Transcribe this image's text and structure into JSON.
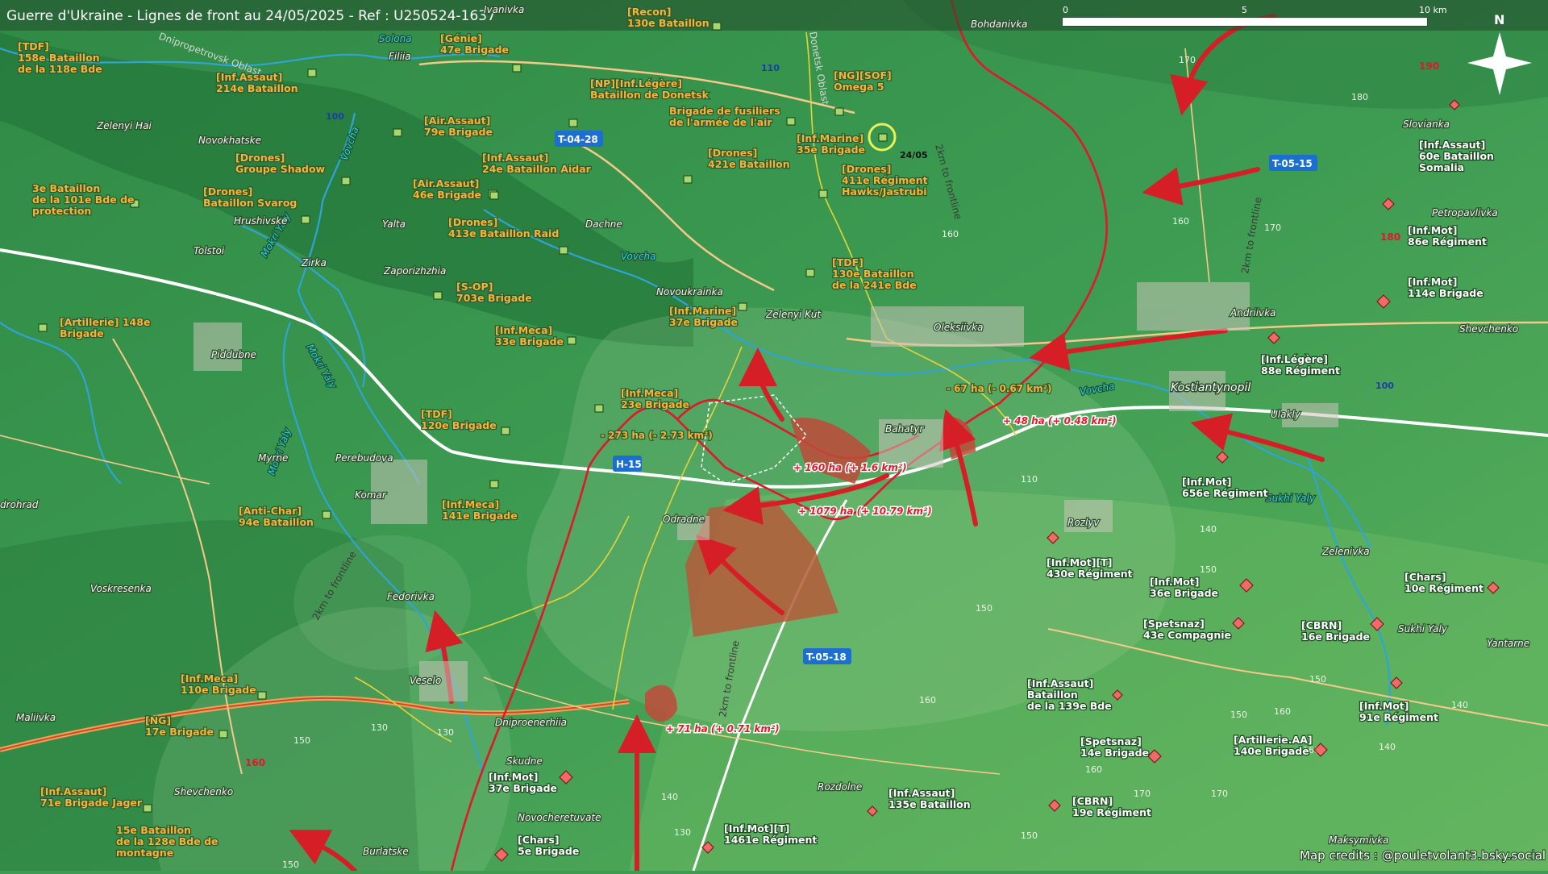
{
  "header": {
    "title": "Guerre d'Ukraine - Lignes de front au 24/05/2025 - Ref : U250524-1637",
    "scale_labels": [
      "0",
      "5",
      "10 km"
    ],
    "north": "N"
  },
  "credits": "Map credits : @pouletvolant3.bsky.social",
  "colors": {
    "ua_unit": "#9fd36a",
    "ru_unit": "#f06a6a",
    "front_line": "#e0182a",
    "arrow": "#d61e26",
    "gain_area": "#b55a3a"
  },
  "towns": [
    "Zelenyi Hai",
    "Novokhatske",
    "Tolstoi",
    "Zirka",
    "Yalta",
    "Hrushivske",
    "Zaporizhzhia",
    "Dachne",
    "Piddubne",
    "Myrne",
    "Perebudova",
    "Komar",
    "drohrad",
    "Voskresenka",
    "Fedorivka",
    "Veselo",
    "Maliivka",
    "Shevchenko",
    "Burlatske",
    "Skudne",
    "Dniproenerhiia",
    "Novocheretuvate",
    "Rozdolne",
    "Odradne",
    "Novoukrainka",
    "Zelenyi Kut",
    "Oleksiivka",
    "Bahatyr",
    "Rozlyv",
    "Kostiantynopil",
    "Andriivka",
    "Ulakly",
    "Zelenivka",
    "Sukhi Yaly",
    "Yantarne",
    "Maksymivka",
    "Slovianka",
    "Petropavlivka",
    "Shevchenko",
    "Bohdanivka",
    "Filiia",
    "Ivanivka"
  ],
  "rivers": [
    "Solona",
    "Vovcha",
    "Mokri Yaly",
    "Mokri Yaly",
    "Mokri Yaly",
    "Vovcha",
    "Vovcha",
    "Sukhi Yaly"
  ],
  "roads": [
    "T-04-28",
    "H-15",
    "T-05-18",
    "T-05-15",
    "110",
    "100",
    "100"
  ],
  "oblast_labels": [
    "Donetsk Oblast",
    "Dnipropetrovsk Oblast"
  ],
  "ua_units": [
    {
      "l1": "[TDF]",
      "l2": "158e Bataillon",
      "l3": "de la 118e Bde"
    },
    {
      "l1": "[Inf.Assaut]",
      "l2": "214e Bataillon"
    },
    {
      "l1": "[Génie]",
      "l2": "47e Brigade"
    },
    {
      "l1": "[Recon]",
      "l2": "130e Bataillon"
    },
    {
      "l1": "[NP][Inf.Légère]",
      "l2": "Bataillon de Donetsk"
    },
    {
      "l1": "Brigade de fusiliers",
      "l2": "de l'armée de l'air"
    },
    {
      "l1": "[NG][SOF]",
      "l2": "Omega 5"
    },
    {
      "l1": "[Inf.Marine]",
      "l2": "35e Brigade"
    },
    {
      "l1": "[Air.Assaut]",
      "l2": "79e Brigade"
    },
    {
      "l1": "[Drones]",
      "l2": "Groupe Shadow"
    },
    {
      "l1": "[Inf.Assaut]",
      "l2": "24e Bataillon Aidar"
    },
    {
      "l1": "[Drones]",
      "l2": "421e Bataillon"
    },
    {
      "l1": "[Drones]",
      "l2": "411e Régiment",
      "l3": "Hawks/Jastrubi"
    },
    {
      "l1": "3e Bataillon",
      "l2": "de la 101e Bde de",
      "l3": "protection"
    },
    {
      "l1": "[Drones]",
      "l2": "Bataillon Svarog"
    },
    {
      "l1": "[Air.Assaut]",
      "l2": "46e Brigade"
    },
    {
      "l1": "[Drones]",
      "l2": "413e Bataillon Raid"
    },
    {
      "l1": "[TDF]",
      "l2": "130e Bataillon",
      "l3": "de la 241e Bde"
    },
    {
      "l1": "[S-OP]",
      "l2": "703e Brigade"
    },
    {
      "l1": "[Inf.Marine]",
      "l2": "37e Brigade"
    },
    {
      "l1": "[Artillerie] 148e",
      "l2": "Brigade"
    },
    {
      "l1": "[Inf.Meca]",
      "l2": "33e Brigade"
    },
    {
      "l1": "[Inf.Meca]",
      "l2": "23e Brigade"
    },
    {
      "l1": "[TDF]",
      "l2": "120e Brigade"
    },
    {
      "l1": "[Anti-Char]",
      "l2": "94e Bataillon"
    },
    {
      "l1": "[Inf.Meca]",
      "l2": "141e Brigade"
    },
    {
      "l1": "[Inf.Meca]",
      "l2": "110e Brigade"
    },
    {
      "l1": "[NG]",
      "l2": "17e Brigade"
    },
    {
      "l1": "[Inf.Assaut]",
      "l2": "71e Brigade Jager"
    },
    {
      "l1": "15e Bataillon",
      "l2": "de la 128e Bde de",
      "l3": "montagne"
    }
  ],
  "ru_units": [
    {
      "l1": "[Inf.Assaut]",
      "l2": "60e Bataillon",
      "l3": "Somalia"
    },
    {
      "l1": "[Inf.Mot]",
      "l2": "86e Régiment"
    },
    {
      "l1": "[Inf.Mot]",
      "l2": "114e Brigade"
    },
    {
      "l1": "[Inf.Légère]",
      "l2": "88e Régiment"
    },
    {
      "l1": "[Inf.Mot]",
      "l2": "656e Régiment"
    },
    {
      "l1": "[Inf.Mot][T]",
      "l2": "430e Régiment"
    },
    {
      "l1": "[Inf.Mot]",
      "l2": "36e Brigade"
    },
    {
      "l1": "[Chars]",
      "l2": "10e Régiment"
    },
    {
      "l1": "[Spetsnaz]",
      "l2": "43e Compagnie"
    },
    {
      "l1": "[CBRN]",
      "l2": "16e Brigade"
    },
    {
      "l1": "[Inf.Assaut]",
      "l2": "Bataillon",
      "l3": "de la 139e Bde"
    },
    {
      "l1": "[Inf.Mot]",
      "l2": "91e Régiment"
    },
    {
      "l1": "[Spetsnaz]",
      "l2": "14e Brigade"
    },
    {
      "l1": "[Artillerie.AA]",
      "l2": "140e Brigade"
    },
    {
      "l1": "[CBRN]",
      "l2": "19e Régiment"
    },
    {
      "l1": "[Inf.Assaut]",
      "l2": "135e Bataillon"
    },
    {
      "l1": "[Inf.Mot][T]",
      "l2": "1461e Régiment"
    },
    {
      "l1": "[Inf.Mot]",
      "l2": "37e Brigade"
    },
    {
      "l1": "[Chars]",
      "l2": "5e Brigade"
    }
  ],
  "changes": [
    "- 273 ha (- 2.73 km²)",
    "- 67 ha (- 0.67 km²)",
    "+ 48 ha (+ 0.48 km²)",
    "+ 160 ha (+ 1.6 km²)",
    "+ 1079 ha (+ 10.79 km²)",
    "+ 71 ha (+ 0.71 km²)"
  ],
  "annotations": {
    "date_marker": "24/05",
    "frontline": "2km to frontline"
  },
  "elevations": [
    "170",
    "190",
    "180",
    "180",
    "170",
    "160",
    "160",
    "110",
    "140",
    "150",
    "150",
    "150",
    "140",
    "130",
    "150",
    "160",
    "150",
    "160",
    "160",
    "160",
    "140",
    "130",
    "150",
    "150",
    "170",
    "130",
    "170",
    "140",
    "150",
    "160",
    "150"
  ],
  "elevations_red": [
    "190",
    "180",
    "160"
  ]
}
